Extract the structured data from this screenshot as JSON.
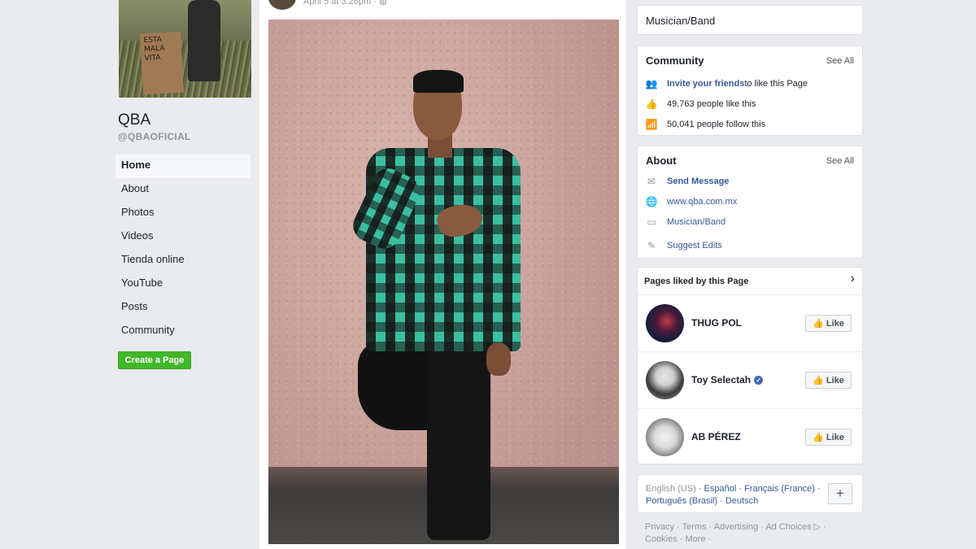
{
  "page": {
    "name": "QBA",
    "handle": "@QBAOFICIAL",
    "cover_sign_text": "ESTA MALA VITA"
  },
  "nav": [
    {
      "label": "Home",
      "active": true
    },
    {
      "label": "About"
    },
    {
      "label": "Photos"
    },
    {
      "label": "Videos"
    },
    {
      "label": "Tienda online"
    },
    {
      "label": "YouTube"
    },
    {
      "label": "Posts"
    },
    {
      "label": "Community"
    }
  ],
  "create_page_label": "Create a Page",
  "post": {
    "timestamp": "April 5 at 3:26pm · ",
    "privacy_icon": "globe-icon"
  },
  "category_card": {
    "label": "Musician/Band"
  },
  "community": {
    "title": "Community",
    "see_all": "See All",
    "invite_link": "Invite your friends",
    "invite_rest": " to like this Page",
    "likes": "49,763 people like this",
    "follows": "50,041 people follow this"
  },
  "about": {
    "title": "About",
    "see_all": "See All",
    "send_message": "Send Message",
    "website": "www.qba.com.mx",
    "category": "Musician/Band",
    "suggest_edits": "Suggest Edits"
  },
  "pages_liked": {
    "title": "Pages liked by this Page",
    "like_label": "Like",
    "items": [
      {
        "name": "THUG POL",
        "verified": false
      },
      {
        "name": "Toy Selectah",
        "verified": true
      },
      {
        "name": "AB PÉREZ",
        "verified": false
      }
    ]
  },
  "languages": {
    "current": "English (US)",
    "sep": " · ",
    "others": [
      "Español",
      "Français (France)",
      "Português (Brasil)",
      "Deutsch"
    ],
    "plus": "+"
  },
  "footer": {
    "links": "Privacy · Terms · Advertising · Ad Choices ▷ · Cookies · More ·"
  },
  "colors": {
    "background": "#e9ebee",
    "link": "#365899",
    "create_button": "#42b72a",
    "shirt_teal": "#3bbfa0"
  }
}
